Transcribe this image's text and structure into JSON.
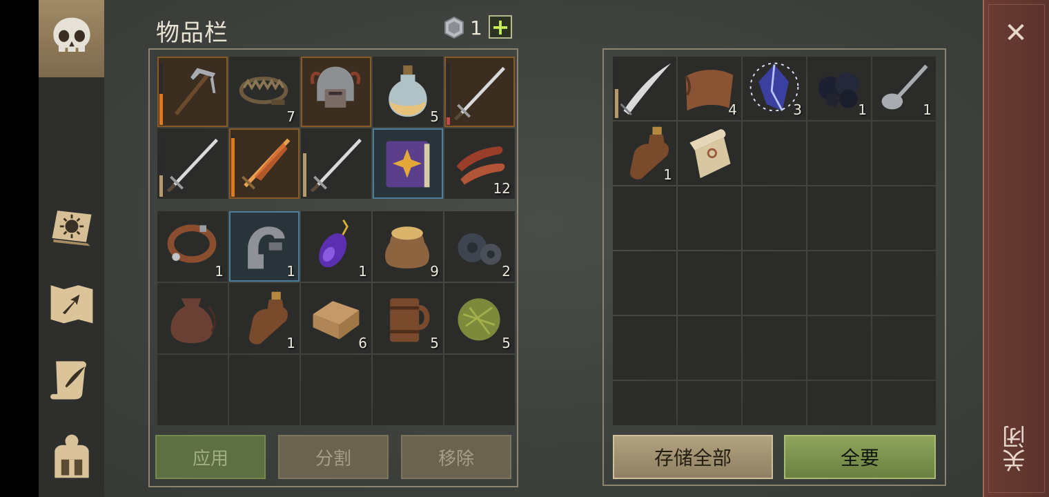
{
  "inventory": {
    "title": "物品栏",
    "currency_count": "1",
    "plus_label": "+",
    "equipment_slots": [
      {
        "icon": "pickaxe-icon",
        "count": "",
        "durability": 0.5,
        "dur_color": "#e07b1c",
        "style": "orange"
      },
      {
        "icon": "bear-trap-icon",
        "count": "7",
        "style": ""
      },
      {
        "icon": "helmet-icon",
        "count": "",
        "style": "orange"
      },
      {
        "icon": "potion-flask-icon",
        "count": "5",
        "style": ""
      },
      {
        "icon": "sword-icon",
        "count": "",
        "durability": 0.12,
        "dur_color": "#c0494a",
        "style": "orange"
      },
      {
        "icon": "sword-icon",
        "count": "",
        "durability": 0.35,
        "dur_color": "#b59a6e",
        "style": ""
      },
      {
        "icon": "flaming-sword-icon",
        "count": "",
        "durability": 0.95,
        "dur_color": "#e07b1c",
        "style": "orange"
      },
      {
        "icon": "sword-icon",
        "count": "",
        "durability": 0.7,
        "dur_color": "#b59a6e",
        "style": ""
      },
      {
        "icon": "spell-book-icon",
        "count": "",
        "style": "blue"
      },
      {
        "icon": "meat-strips-icon",
        "count": "12",
        "style": ""
      }
    ],
    "bag_slots": [
      {
        "icon": "leather-collar-icon",
        "count": "1",
        "style": ""
      },
      {
        "icon": "iron-clamp-icon",
        "count": "1",
        "style": "blue"
      },
      {
        "icon": "purple-amulet-icon",
        "count": "1",
        "style": ""
      },
      {
        "icon": "grain-sack-icon",
        "count": "9",
        "style": ""
      },
      {
        "icon": "gear-parts-icon",
        "count": "2",
        "style": ""
      },
      {
        "icon": "leather-pouch-icon",
        "count": "",
        "style": ""
      },
      {
        "icon": "bottle-icon",
        "count": "1",
        "style": ""
      },
      {
        "icon": "folded-cloth-icon",
        "count": "6",
        "style": ""
      },
      {
        "icon": "wooden-mug-icon",
        "count": "5",
        "style": ""
      },
      {
        "icon": "herb-ball-icon",
        "count": "5",
        "style": ""
      },
      {
        "icon": "",
        "count": "",
        "style": ""
      },
      {
        "icon": "",
        "count": "",
        "style": ""
      },
      {
        "icon": "",
        "count": "",
        "style": ""
      },
      {
        "icon": "",
        "count": "",
        "style": ""
      },
      {
        "icon": "",
        "count": "",
        "style": ""
      }
    ],
    "buttons": {
      "apply": "应用",
      "split": "分割",
      "remove": "移除"
    }
  },
  "chest": {
    "slots": [
      {
        "icon": "curved-blade-icon",
        "count": "",
        "durability": 0.5,
        "dur_color": "#b59a6e"
      },
      {
        "icon": "leather-scrap-icon",
        "count": "4"
      },
      {
        "icon": "crystal-shard-icon",
        "count": "3"
      },
      {
        "icon": "coal-icon",
        "count": "1"
      },
      {
        "icon": "spoon-icon",
        "count": "1"
      },
      {
        "icon": "bottle-icon",
        "count": "1"
      },
      {
        "icon": "scroll-icon",
        "count": ""
      }
    ],
    "total_slots": 30,
    "buttons": {
      "store_all": "存储全部",
      "take_all": "全要"
    }
  },
  "close": {
    "x": "✕",
    "label": "关闭"
  },
  "sidebar": [
    "skull-icon",
    "sun-book-icon",
    "map-arrow-icon",
    "quill-scroll-icon",
    "backpack-icon"
  ]
}
